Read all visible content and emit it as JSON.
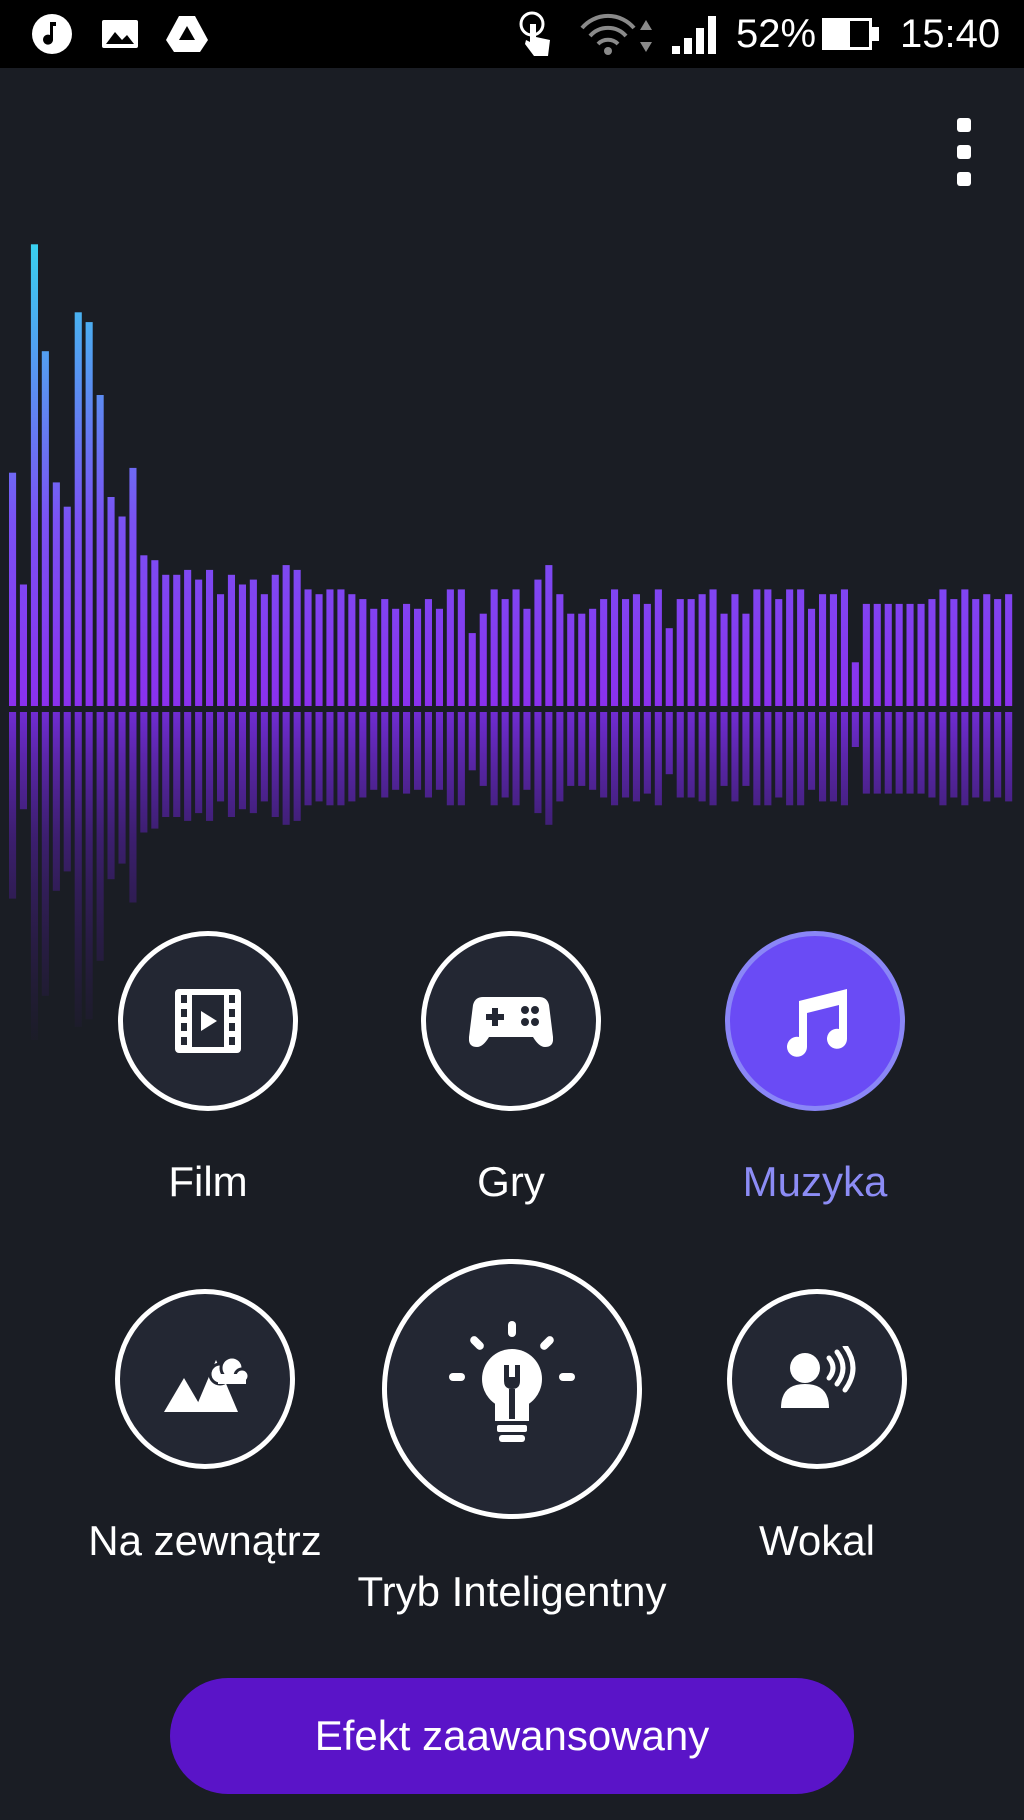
{
  "status_bar": {
    "icons": [
      "music-note-icon",
      "image-icon",
      "drive-icon",
      "touch-icon",
      "wifi-icon",
      "signal-icon",
      "battery-icon"
    ],
    "battery": "52%",
    "time": "15:40"
  },
  "colors": {
    "background": "#1a1d24",
    "accent": "#6a4bf5",
    "active_label": "#8c8cf5",
    "advanced_button": "#5a14c8",
    "bar_top": "#38d3f0",
    "bar_bottom": "#8a30ee"
  },
  "modes": {
    "film": {
      "label": "Film",
      "icon": "film-icon"
    },
    "games": {
      "label": "Gry",
      "icon": "gamepad-icon"
    },
    "music": {
      "label": "Muzyka",
      "icon": "music-note-icon",
      "selected": true
    },
    "outdoor": {
      "label": "Na zewnątrz",
      "icon": "mountains-cloud-icon"
    },
    "smart": {
      "label": "Tryb Inteligentny",
      "icon": "smart-bulb-icon"
    },
    "vocal": {
      "label": "Wokal",
      "icon": "voice-icon"
    }
  },
  "advanced_button": {
    "label": "Efekt zaawansowany"
  },
  "chart_data": {
    "type": "bar",
    "values": [
      0.48,
      0.25,
      0.95,
      0.73,
      0.46,
      0.41,
      0.81,
      0.79,
      0.64,
      0.43,
      0.39,
      0.49,
      0.31,
      0.3,
      0.27,
      0.27,
      0.28,
      0.26,
      0.28,
      0.23,
      0.27,
      0.25,
      0.26,
      0.23,
      0.27,
      0.29,
      0.28,
      0.24,
      0.23,
      0.24,
      0.24,
      0.23,
      0.22,
      0.2,
      0.22,
      0.2,
      0.21,
      0.2,
      0.22,
      0.2,
      0.24,
      0.24,
      0.15,
      0.19,
      0.24,
      0.22,
      0.24,
      0.2,
      0.26,
      0.29,
      0.23,
      0.19,
      0.19,
      0.2,
      0.22,
      0.24,
      0.22,
      0.23,
      0.21,
      0.24,
      0.16,
      0.22,
      0.22,
      0.23,
      0.24,
      0.19,
      0.23,
      0.19,
      0.24,
      0.24,
      0.22,
      0.24,
      0.24,
      0.2,
      0.23,
      0.23,
      0.24,
      0.09,
      0.21,
      0.21,
      0.21,
      0.21,
      0.21,
      0.21,
      0.22,
      0.24,
      0.22,
      0.24,
      0.22,
      0.23,
      0.22,
      0.23
    ]
  }
}
